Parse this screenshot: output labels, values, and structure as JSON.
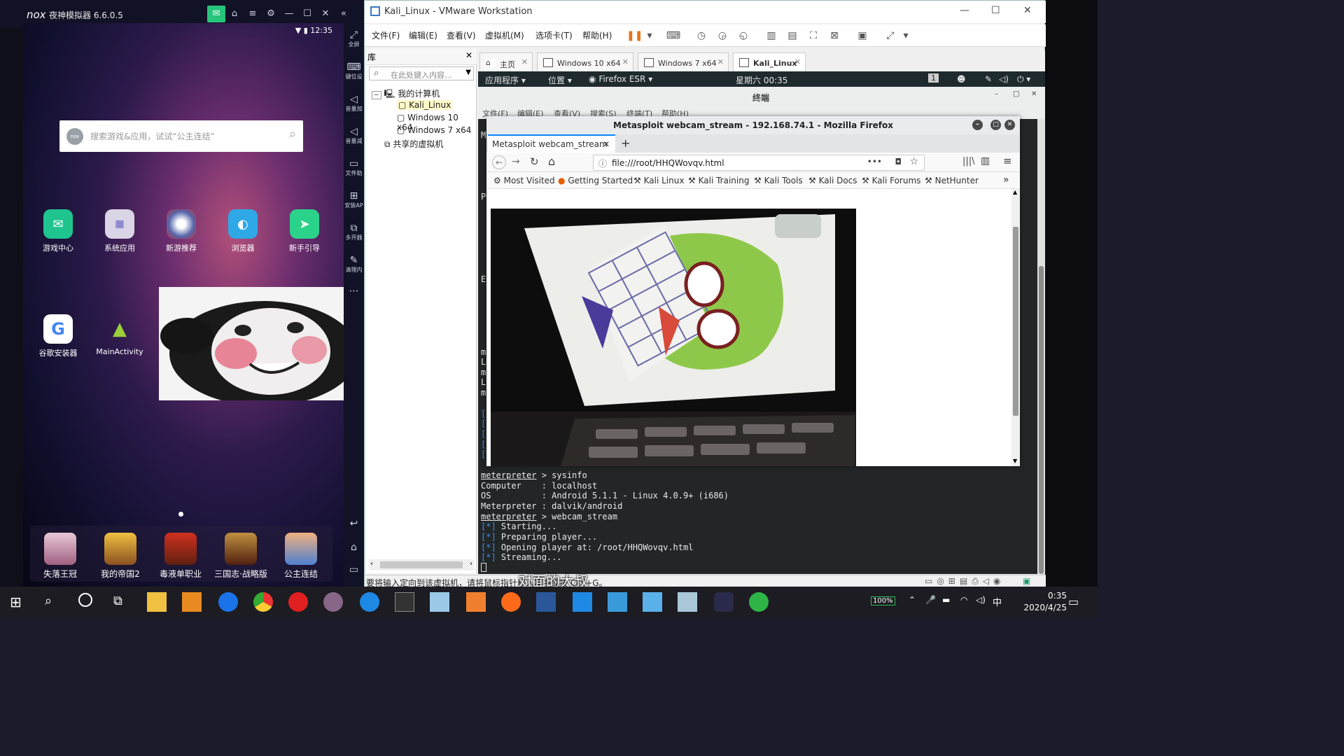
{
  "nox": {
    "logo": "nox",
    "title": "夜神模拟器 6.6.0.5",
    "time": "12:35",
    "search_placeholder": "搜索游戏&应用，试试“公主连结”",
    "search_logo": "nox",
    "apps_row1": [
      "游戏中心",
      "系统应用",
      "新游推荐",
      "浏览器",
      "新手引导"
    ],
    "apps_row2": [
      "谷歌安装器",
      "MainActivity"
    ],
    "dock": [
      "失落王冠",
      "我的帝国2",
      "毒液单职业",
      "三国志·战略版",
      "公主连结"
    ],
    "side": [
      "全屏",
      "键位设",
      "音量加",
      "音量减",
      "文件助",
      "安装AP",
      "多开器",
      "清理内"
    ]
  },
  "vmware": {
    "title": "Kali_Linux - VMware Workstation",
    "menu": [
      "文件(F)",
      "编辑(E)",
      "查看(V)",
      "虚拟机(M)",
      "选项卡(T)",
      "帮助(H)"
    ],
    "library": {
      "title": "库",
      "search_placeholder": "在此处键入内容...",
      "root": "我的计算机",
      "vms": [
        "Kali_Linux",
        "Windows 10 x64",
        "Windows 7 x64"
      ],
      "shared": "共享的虚拟机"
    },
    "tabs": [
      "主页",
      "Windows 10 x64",
      "Windows 7 x64",
      "Kali_Linux"
    ],
    "status": "要将输入定向到该虚拟机，请将鼠标指针移入其中或按 Ctrl+G。"
  },
  "kali": {
    "apps": "应用程序",
    "places": "位置",
    "browser": "Firefox ESR",
    "clock": "星期六 00:35",
    "workspace": "1",
    "terminal_title": "终端",
    "terminal_menu": [
      "文件(F)",
      "编辑(E)",
      "查看(V)",
      "搜索(S)",
      "终端(T)",
      "帮助(H)"
    ],
    "term_left": [
      "M",
      "P",
      "E",
      "m",
      "L",
      "m",
      "L",
      "m",
      "[",
      "[",
      "[",
      "[",
      "["
    ],
    "term_lines": [
      {
        "prompt": "meterpreter",
        "rest": " > sysinfo"
      },
      {
        "prompt": "",
        "rest": "Computer    : localhost"
      },
      {
        "prompt": "",
        "rest": "OS          : Android 5.1.1 - Linux 4.0.9+ (i686)"
      },
      {
        "prompt": "",
        "rest": "Meterpreter : dalvik/android"
      },
      {
        "prompt": "meterpreter",
        "rest": " > webcam_stream"
      },
      {
        "tag": "[*]",
        "rest": " Starting..."
      },
      {
        "tag": "[*]",
        "rest": " Preparing player..."
      },
      {
        "tag": "[*]",
        "rest": " Opening player at: /root/HHQWovqv.html"
      },
      {
        "tag": "[*]",
        "rest": " Streaming..."
      }
    ]
  },
  "firefox": {
    "title": "Metasploit webcam_stream - 192.168.74.1 - Mozilla Firefox",
    "tab": "Metasploit webcam_stream",
    "url": "file:///root/HHQWovqv.html",
    "bookmarks": [
      "Most Visited",
      "Getting Started",
      "Kali Linux",
      "Kali Training",
      "Kali Tools",
      "Kali Docs",
      "Kali Forums",
      "NetHunter"
    ]
  },
  "subtitle": "对面的大叔",
  "taskbar": {
    "battery": "100%",
    "ime": "中",
    "time": "0:35",
    "date": "2020/4/25"
  }
}
